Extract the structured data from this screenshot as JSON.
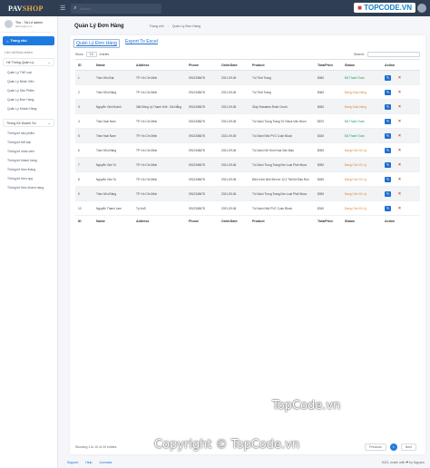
{
  "header": {
    "brand_part1": "PAV",
    "brand_part2": "SHOP",
    "menu_icon": "hamburger-icon",
    "search_placeholder": "Search...",
    "search_icon": "search-icon",
    "watermark_tld": "TOPCODE.VN"
  },
  "sidebar": {
    "user_name": "Thu - Tài Lê admin",
    "user_email": "admin@vn.vn",
    "home_label": "Trang chủ",
    "section_title": "Liên hệ/Nhân khiếm",
    "group1": {
      "label": "Hệ Thống Quản Lý",
      "items": [
        "Quản Lý Thể Loại",
        "Quản Lý Nhân Viên",
        "Quản Lý Sản Phẩm",
        "Quản Lý Đơn Hàng",
        "Quản Lý Khách Hàng"
      ]
    },
    "group2": {
      "label": "Thống Kê Doanh Số",
      "items": [
        "Thống kê sản phẩm",
        "Thống kê thể loại",
        "Thống kê nhân viên",
        "Thống kê khách hàng",
        "Thống kê theo tháng",
        "Thống kê theo quý",
        "Thống kê theo khách hàng"
      ]
    }
  },
  "main": {
    "page_title": "Quản Lý Đơn Hàng",
    "breadcrumbs": [
      "Trang chủ",
      "Quản Lý Đơn Hàng"
    ],
    "tabs": [
      "Quản Lý Đơn Hàng",
      "Export To Excel"
    ],
    "show_label": "Show",
    "entries_value": "10",
    "entries_label": "entries",
    "search_label": "Search:",
    "columns": [
      "ID",
      "Name",
      "Address",
      "Phone",
      "OrderDate",
      "Product",
      "TotalPrice",
      "Status",
      "Action"
    ],
    "rows": [
      [
        "1",
        "Trần Hữu Đạt",
        "TP. Hồ Chí Minh",
        "0912345678",
        "2021-09-06",
        "Túi Thời Trang",
        "$360",
        "Đã Thanh Toán"
      ],
      [
        "2",
        "Trần Hữu Đăng",
        "TP. Hồ Chí Minh",
        "0912345678",
        "2021-09-06",
        "Túi Thời Trang",
        "$360",
        "Đang Giao Hàng"
      ],
      [
        "3",
        "Nguyễn Văn Khánh",
        "266 Đông Lý Thanh Khê - Đà Nẵng",
        "0912345678",
        "2021-09-06",
        "Giày Sneakers Rush Crush",
        "$450",
        "Đang Giao Hàng"
      ],
      [
        "4",
        "Trần Hoài Nam",
        "TP. Hồ Chí Minh",
        "0912345678",
        "2021-09-06",
        "Túi Xách Trung Trang Từ Nhựa Văn Nhọn",
        "$570",
        "Đã Thanh Toán"
      ],
      [
        "5",
        "Trần Hoài Nam",
        "TP. Hồ Chí Minh",
        "0912345678",
        "2021-09-06",
        "Túi Xách Nhỏ PVC Color Block",
        "$340",
        "Đã Thanh Toán"
      ],
      [
        "6",
        "Trần Hữu Đăng",
        "TP. Hồ Chí Minh",
        "0912345678",
        "2021-09-06",
        "Túi Xách Nữ Hình Hoa Văn Màu",
        "$390",
        "Đang Chờ Xử Lý"
      ],
      [
        "7",
        "Nguyễn Văn Tú",
        "TP. Hồ Chí Minh",
        "0912345678",
        "2021-09-06",
        "Túi Xách Trung Trang Kim Loại Phối Nhựa",
        "$390",
        "Đang Chờ Xử Lý"
      ],
      [
        "8",
        "Nguyễn Văn Tú",
        "TP. Hồ Chí Minh",
        "0912345678",
        "2021-09-06",
        "Điện Kính Nhỏ Đen từ 12.2 Tiết Kế Đầu Ron",
        "$450",
        "Đang Chờ Xử Lý"
      ],
      [
        "9",
        "Trần Hữu Đăng",
        "TP. Hồ Chí Minh",
        "0912345678",
        "2021-09-06",
        "Túi Xách Trung Trang Kim Loại Phối Nhựa",
        "$390",
        "Đang Chờ Xử Lý"
      ],
      [
        "10",
        "Nguyễn Thanh Lam",
        "Tp.HoS",
        "0912345678",
        "2021-09-06",
        "Túi Xách Nhỏ PVC Color Block",
        "$340",
        "Đang Chờ Xử Lý"
      ]
    ],
    "status_icon_edit": "edit-icon",
    "status_icon_delete": "delete-icon",
    "info_text": "Showing 1 to 10 of 20 entries",
    "pager_prev": "Previous",
    "pager_current": "1",
    "pager_next": "Next"
  },
  "footer": {
    "links": [
      "Support",
      "Help",
      "Licenses"
    ],
    "copyright": "2021, made with ❤ by Nguyen"
  },
  "watermarks": {
    "center": "TopCode.vn",
    "bottom": "Copyright © TopCode.vn"
  }
}
